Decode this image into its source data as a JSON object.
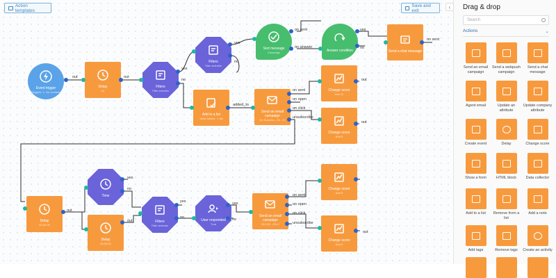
{
  "toolbar": {
    "templates_label": "Action templates",
    "save_label": "Save and exit",
    "nav_glyph": "›"
  },
  "panel": {
    "title": "Drag & drop",
    "search_placeholder": "Search",
    "section": "Actions",
    "section_chevron": "⌄",
    "collapse_glyph": "‹"
  },
  "nodes": [
    {
      "id": "n1",
      "title": "Event trigger",
      "sub": "Triggers: 1, No contacts"
    },
    {
      "id": "n2",
      "title": "Delay",
      "sub": "1d"
    },
    {
      "id": "n3",
      "title": "Filters",
      "sub": "Filter selected"
    },
    {
      "id": "n4",
      "title": "Filters",
      "sub": "Filter selected"
    },
    {
      "id": "n5",
      "title": "Sort message",
      "sub": "Campaign"
    },
    {
      "id": "n6",
      "title": "Answer condition",
      "sub": ""
    },
    {
      "id": "n7",
      "title": "Send a chat message",
      "sub": ""
    },
    {
      "id": "n8",
      "title": "Add to a list",
      "sub": "Adds Added - 1 list"
    },
    {
      "id": "n9",
      "title": "Send an email campaign",
      "sub": "On Success - 06 - 17"
    },
    {
      "id": "n10",
      "title": "Change score",
      "sub": "Add 10"
    },
    {
      "id": "n11",
      "title": "Change score",
      "sub": "Add 5"
    },
    {
      "id": "n12",
      "title": "Delay",
      "sub": "00:00:00"
    },
    {
      "id": "n13",
      "title": "Time",
      "sub": ""
    },
    {
      "id": "n14",
      "title": "Delay",
      "sub": "00:00:00"
    },
    {
      "id": "n15",
      "title": "Filters",
      "sub": "Filter selected"
    },
    {
      "id": "n16",
      "title": "User responded",
      "sub": "True"
    },
    {
      "id": "n17",
      "title": "Send an email campaign",
      "sub": "09:3:30 - 09:17"
    },
    {
      "id": "n18",
      "title": "Change score",
      "sub": "Add 5"
    },
    {
      "id": "n19",
      "title": "Change score",
      "sub": "Add 5"
    }
  ],
  "labels": {
    "l1": "out",
    "l2": "out",
    "l3": "yes",
    "l4": "no",
    "l5": "yes",
    "l6": "no",
    "l7": "on sent",
    "l8": "on answer",
    "l9": "yes",
    "l10": "no",
    "l11": "on sent",
    "l12": "added_to",
    "l13": "on sent",
    "l14": "on open",
    "l15": "on click",
    "l16": "unsubscribe",
    "l17": "out",
    "l18": "out",
    "l19": "yes",
    "l20": "no",
    "l21": "out",
    "l22": "yes",
    "l23": "no",
    "l24": "yes",
    "l25": "no",
    "l26": "on sent",
    "l27": "on open",
    "l28": "on click",
    "l29": "unsubscribe",
    "l30": "out",
    "l31": "out"
  },
  "actions": [
    {
      "label": "Send an email campaign",
      "icon": "email-campaign-icon"
    },
    {
      "label": "Send a webpush campaign",
      "icon": "webpush-icon"
    },
    {
      "label": "Send a chat message",
      "icon": "chat-message-icon"
    },
    {
      "label": "Agent email",
      "icon": "agent-email-icon"
    },
    {
      "label": "Update an attribute",
      "icon": "update-attribute-icon"
    },
    {
      "label": "Update company attribute",
      "icon": "company-attribute-icon"
    },
    {
      "label": "Create event",
      "icon": "create-event-icon"
    },
    {
      "label": "Delay",
      "icon": "delay-icon"
    },
    {
      "label": "Change score",
      "icon": "change-score-icon"
    },
    {
      "label": "Show a form",
      "icon": "form-icon"
    },
    {
      "label": "HTML block",
      "icon": "html-block-icon"
    },
    {
      "label": "Data collector",
      "icon": "data-collector-icon"
    },
    {
      "label": "Add to a list",
      "icon": "add-to-list-icon"
    },
    {
      "label": "Remove from a list",
      "icon": "remove-from-list-icon"
    },
    {
      "label": "Add a note",
      "icon": "note-icon"
    },
    {
      "label": "Add tags",
      "icon": "add-tags-icon"
    },
    {
      "label": "Remove tags",
      "icon": "remove-tags-icon"
    },
    {
      "label": "Create an activity",
      "icon": "activity-icon"
    },
    {
      "label": "",
      "icon": "action-icon"
    },
    {
      "label": "",
      "icon": "action-icon"
    },
    {
      "label": "",
      "icon": "action-icon"
    }
  ],
  "colors": {
    "action": "#f79a3e",
    "trigger": "#5aa3e8",
    "filter": "#6a63d9",
    "condition": "#47bd6e",
    "link": "#2d2d2d",
    "accent": "#3f86c0"
  }
}
